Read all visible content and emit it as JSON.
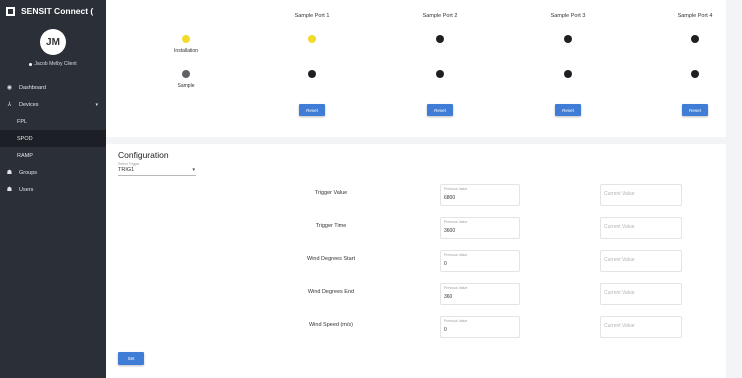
{
  "app": {
    "title": "SENSIT Connect ("
  },
  "user": {
    "initials": "JM",
    "name": "Jacob Melby Client"
  },
  "nav": {
    "items": [
      {
        "label": "Dashboard",
        "icon": "dashboard-icon"
      },
      {
        "label": "Devices",
        "icon": "devices-icon"
      },
      {
        "label": "FPL"
      },
      {
        "label": "SPOD"
      },
      {
        "label": "RAMP"
      },
      {
        "label": "Groups",
        "icon": "groups-icon"
      },
      {
        "label": "Users",
        "icon": "users-icon"
      }
    ]
  },
  "ports": {
    "headers": [
      "Sample Port 1",
      "Sample Port 2",
      "Sample Port 3",
      "Sample Port 4"
    ],
    "rows": [
      {
        "label": "Installation",
        "status": [
          "on",
          "off",
          "off",
          "off"
        ],
        "label_dot": "on"
      },
      {
        "label": "Sample",
        "status": [
          "off",
          "off",
          "off",
          "off"
        ],
        "label_dot": "grey"
      }
    ],
    "reset_label": "Reset"
  },
  "config": {
    "title": "Configuration",
    "select_label": "Select Trigger",
    "select_value": "TRIG1",
    "fields": [
      {
        "label": "Trigger Value",
        "previous": "6800"
      },
      {
        "label": "Trigger Time",
        "previous": "3600"
      },
      {
        "label": "Wind Degrees Start",
        "previous": "0"
      },
      {
        "label": "Wind Degrees End",
        "previous": "360"
      },
      {
        "label": "Wind Speed (m/s)",
        "previous": "0"
      }
    ],
    "previous_label": "Previous Value",
    "current_placeholder": "Current Value",
    "set_label": "Set"
  },
  "colors": {
    "active_dot": "#f2dc2a",
    "inactive_dot": "#1e1f22",
    "grey_dot": "#5f6166",
    "button": "#3f7dd6",
    "sidebar": "#2b3038"
  }
}
